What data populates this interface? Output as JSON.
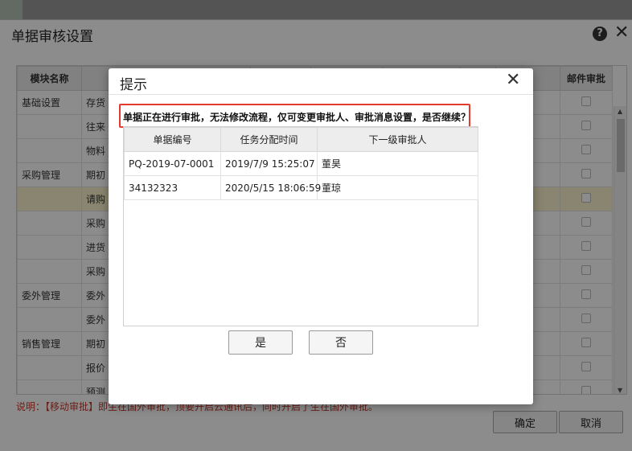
{
  "window": {
    "title": "单据审核设置",
    "help_glyph": "?",
    "close_glyph": "✕",
    "columns": [
      "模块名称",
      "",
      "",
      "",
      "",
      "",
      "",
      "邮件审批"
    ],
    "rows": [
      {
        "module": "基础设置",
        "doc": "存货"
      },
      {
        "module": "",
        "doc": "往来"
      },
      {
        "module": "",
        "doc": "物料"
      },
      {
        "module": "采购管理",
        "doc": "期初"
      },
      {
        "module": "",
        "doc": "请购"
      },
      {
        "module": "",
        "doc": "采购"
      },
      {
        "module": "",
        "doc": "进货"
      },
      {
        "module": "",
        "doc": "采购"
      },
      {
        "module": "委外管理",
        "doc": "委外"
      },
      {
        "module": "",
        "doc": "委外"
      },
      {
        "module": "销售管理",
        "doc": "期初"
      },
      {
        "module": "",
        "doc": "报价"
      },
      {
        "module": "",
        "doc": "预测"
      }
    ],
    "note": "说明：【移动审批】即生在国外审批，顶要开启云通讯后，同时开启了生在国外审批。",
    "confirm_label": "确定",
    "cancel_label": "取消"
  },
  "dialog": {
    "title": "提示",
    "close_glyph": "✕",
    "warning": "单据正在进行审批，无法修改流程，仅可变更审批人、审批消息设置，是否继续？",
    "columns": [
      "单据编号",
      "任务分配时间",
      "下一级审批人"
    ],
    "rows": [
      {
        "code": "PQ-2019-07-0001",
        "time": "2019/7/9 15:25:07",
        "approver": "董昊"
      },
      {
        "code": "34132323",
        "time": "2020/5/15 18:06:59",
        "approver": "董琼"
      }
    ],
    "yes_label": "是",
    "no_label": "否"
  },
  "colors": {
    "highlight_row": "#faf3cc",
    "warning_border": "#e23a2e",
    "note_text": "#c0392b"
  }
}
